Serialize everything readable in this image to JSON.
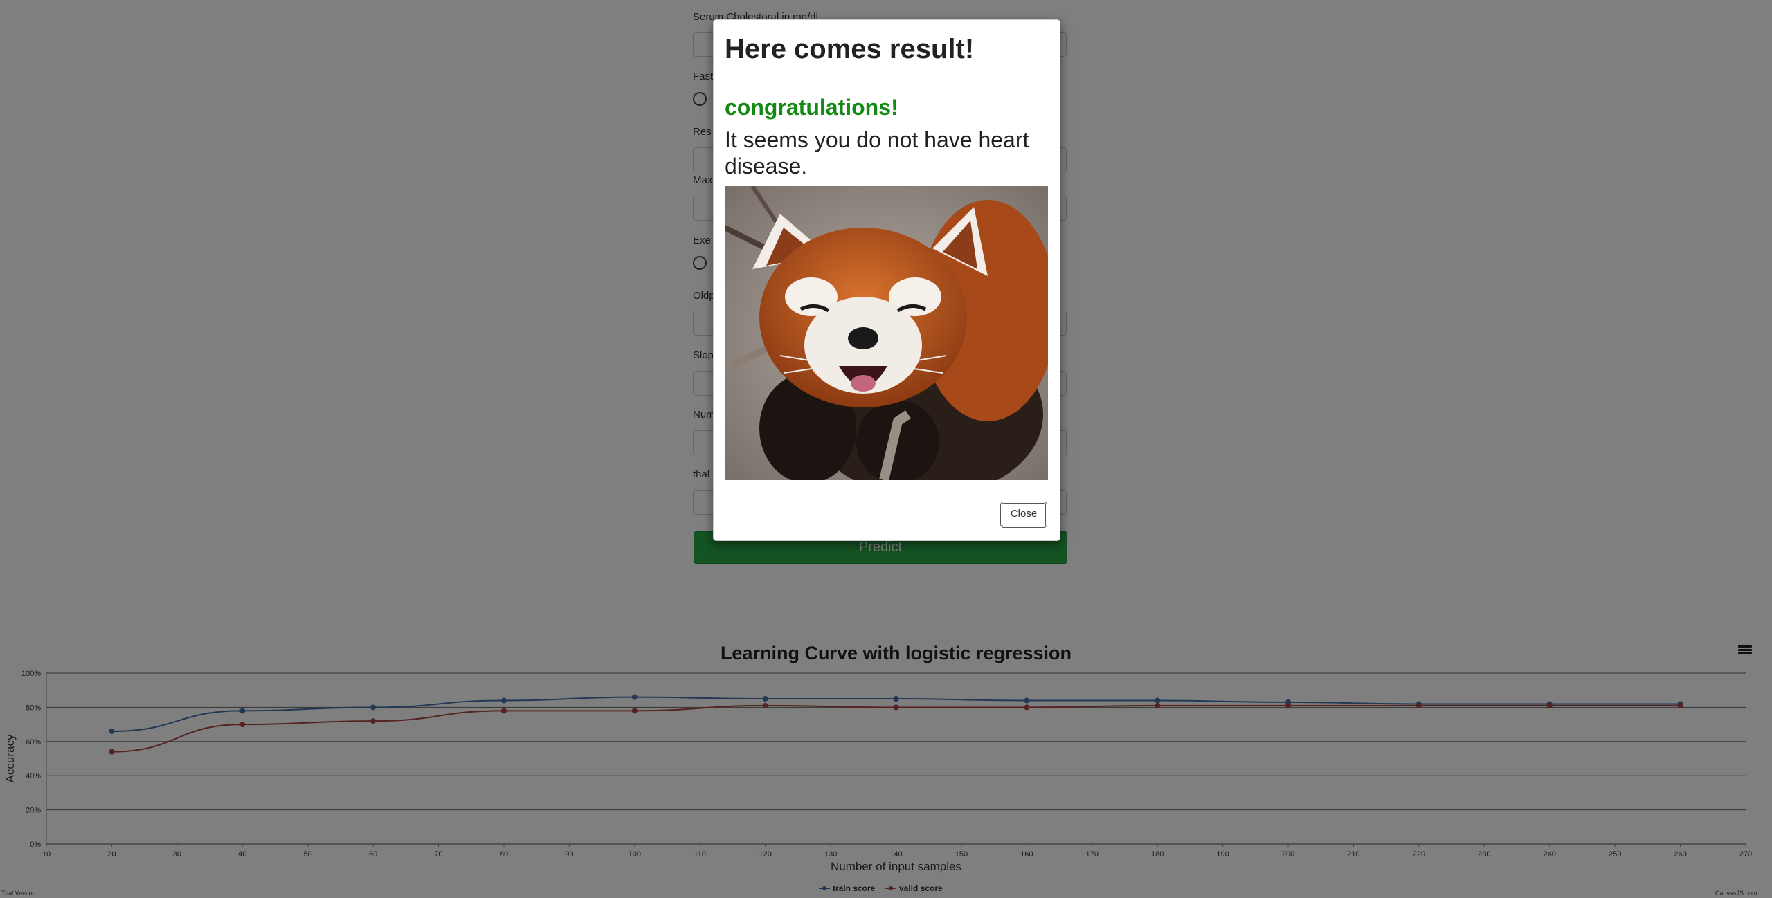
{
  "form": {
    "fields": [
      {
        "label": "Serum Cholestoral in mg/dl",
        "type": "input",
        "value": ""
      },
      {
        "label": "Fast",
        "type": "radio"
      },
      {
        "label": "Res",
        "type": "input",
        "value": ""
      },
      {
        "label": "Max",
        "type": "input",
        "value": ""
      },
      {
        "label": "Exe",
        "type": "radio"
      },
      {
        "label": "Oldp",
        "type": "input",
        "value": ""
      },
      {
        "label": "Slop",
        "type": "input",
        "value": ""
      },
      {
        "label": "Num",
        "type": "input",
        "value": ""
      },
      {
        "label": "thal",
        "type": "input",
        "value": ""
      }
    ],
    "predict_label": "Predict"
  },
  "modal": {
    "title": "Here comes result!",
    "congrats": "congratulations!",
    "message": "It seems you do not have heart disease.",
    "image_alt": "red panda",
    "close_label": "Close"
  },
  "chart_menu_icon": "hamburger-menu-icon",
  "chart_data": {
    "type": "line",
    "title": "Learning Curve with logistic regression",
    "xlabel": "Number of input samples",
    "ylabel": "Accuracy",
    "xlim": [
      10,
      270
    ],
    "xticks": [
      10,
      20,
      30,
      40,
      50,
      60,
      70,
      80,
      90,
      100,
      110,
      120,
      130,
      140,
      150,
      160,
      170,
      180,
      190,
      200,
      210,
      220,
      230,
      240,
      250,
      260,
      270
    ],
    "ylim": [
      0,
      100
    ],
    "yticks": [
      0,
      20,
      40,
      60,
      80,
      100
    ],
    "ytick_suffix": "%",
    "grid": true,
    "legend": "bottom-center",
    "x": [
      20,
      40,
      60,
      80,
      100,
      120,
      140,
      160,
      180,
      200,
      220,
      240,
      260
    ],
    "series": [
      {
        "name": "train score",
        "color": "#4572a7",
        "values": [
          66,
          78,
          80,
          84,
          86,
          85,
          85,
          84,
          84,
          83,
          82,
          82,
          82
        ]
      },
      {
        "name": "valid score",
        "color": "#aa4643",
        "values": [
          54,
          70,
          72,
          78,
          78,
          81,
          80,
          80,
          81,
          81,
          81,
          81,
          81
        ]
      }
    ]
  },
  "trial_text": "Trial Version",
  "watermark": "CanvasJS.com"
}
